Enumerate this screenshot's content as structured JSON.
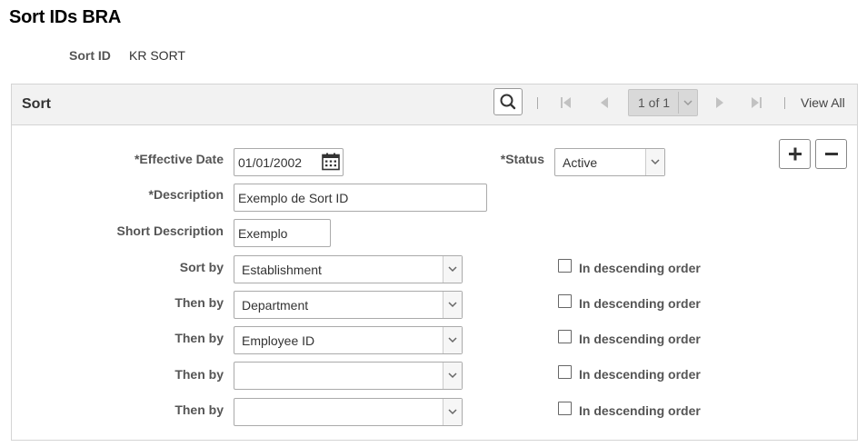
{
  "page": {
    "title": "Sort IDs BRA"
  },
  "key": {
    "label": "Sort ID",
    "value": "KR SORT"
  },
  "panel": {
    "title": "Sort",
    "pager": {
      "text": "1 of 1",
      "view_all": "View All"
    }
  },
  "form": {
    "effective_date": {
      "label": "*Effective Date",
      "value": "01/01/2002"
    },
    "status": {
      "label": "*Status",
      "value": "Active"
    },
    "description": {
      "label": "*Description",
      "value": "Exemplo de Sort ID"
    },
    "short_description": {
      "label": "Short Description",
      "value": "Exemplo"
    },
    "sort_rows": [
      {
        "label": "Sort by",
        "value": "Establishment",
        "desc_label": "In descending order"
      },
      {
        "label": "Then by",
        "value": "Department",
        "desc_label": "In descending order"
      },
      {
        "label": "Then by",
        "value": "Employee ID",
        "desc_label": "In descending order"
      },
      {
        "label": "Then by",
        "value": "",
        "desc_label": "In descending order"
      },
      {
        "label": "Then by",
        "value": "",
        "desc_label": "In descending order"
      }
    ]
  },
  "icons": {
    "search": "search-icon",
    "first": "first-page-icon",
    "prev": "previous-icon",
    "next": "next-icon",
    "last": "last-page-icon",
    "calendar": "calendar-icon",
    "add": "plus-icon",
    "remove": "minus-icon",
    "dropdown": "chevron-down-icon"
  }
}
